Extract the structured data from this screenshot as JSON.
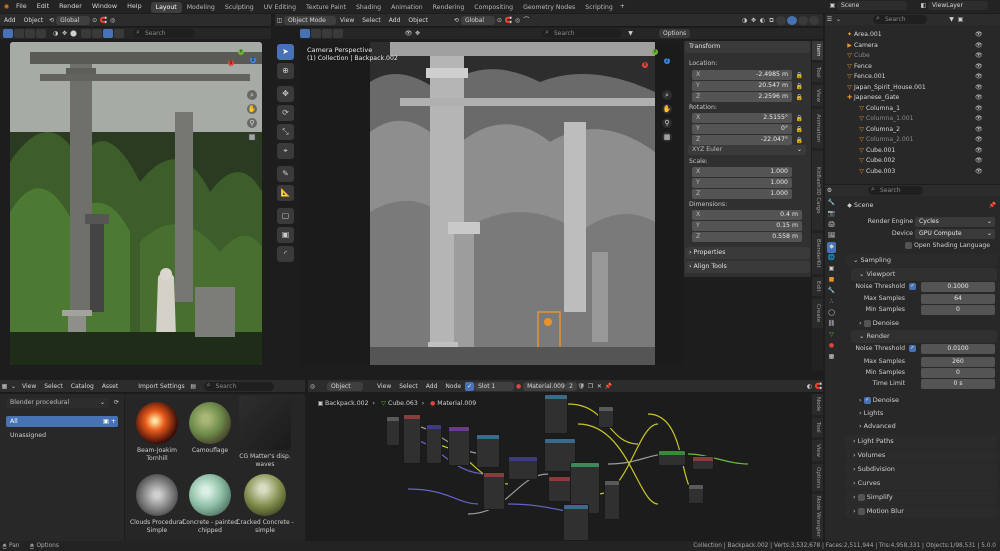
{
  "menubar": {
    "items": [
      "File",
      "Edit",
      "Render",
      "Window",
      "Help"
    ],
    "workspaces": [
      "Layout",
      "Modeling",
      "Sculpting",
      "UV Editing",
      "Texture Paint",
      "Shading",
      "Animation",
      "Rendering",
      "Compositing",
      "Geometry Nodes",
      "Scripting"
    ],
    "active_workspace": "Layout",
    "scene": "Scene",
    "view_layer": "ViewLayer"
  },
  "left_viewport": {
    "header": {
      "add": "Add",
      "object": "Object",
      "orientation": "Global",
      "search_placeholder": "Search"
    }
  },
  "main_viewport": {
    "header": {
      "mode": "Object Mode",
      "view": "View",
      "select": "Select",
      "add": "Add",
      "object": "Object",
      "orientation": "Global",
      "search_placeholder": "Search",
      "options": "Options"
    },
    "overlay_title": "Camera Perspective",
    "overlay_sub": "(1) Collection | Backpack.002"
  },
  "npanel": {
    "tabs": [
      "Item",
      "Tool",
      "View",
      "Animation",
      "KitBash3D Cargo",
      "BlenderKit",
      "Edit",
      "Create"
    ],
    "transform": "Transform",
    "location": "Location:",
    "loc": [
      {
        "k": "X",
        "v": "-2.4985 m"
      },
      {
        "k": "Y",
        "v": "20.547 m"
      },
      {
        "k": "Z",
        "v": "2.2596 m"
      }
    ],
    "rotation": "Rotation:",
    "rot": [
      {
        "k": "X",
        "v": "2.5155°"
      },
      {
        "k": "Y",
        "v": "0°"
      },
      {
        "k": "Z",
        "v": "-22.047°"
      }
    ],
    "rot_mode": "XYZ Euler",
    "scale": "Scale:",
    "scl": [
      {
        "k": "X",
        "v": "1.000"
      },
      {
        "k": "Y",
        "v": "1.000"
      },
      {
        "k": "Z",
        "v": "1.000"
      }
    ],
    "dimensions": "Dimensions:",
    "dim": [
      {
        "k": "X",
        "v": "0.4 m"
      },
      {
        "k": "Y",
        "v": "0.15 m"
      },
      {
        "k": "Z",
        "v": "0.558 m"
      }
    ],
    "properties": "Properties",
    "align_tools": "Align Tools"
  },
  "outliner": {
    "search_placeholder": "Search",
    "rows": [
      {
        "name": "Area.001",
        "indent": 0
      },
      {
        "name": "Camera",
        "indent": 0
      },
      {
        "name": "Cube",
        "indent": 0
      },
      {
        "name": "Fence",
        "indent": 0
      },
      {
        "name": "Fence.001",
        "indent": 0
      },
      {
        "name": "Japan_Spirit_House.001",
        "indent": 0
      },
      {
        "name": "Japanese_Gate",
        "indent": 0
      },
      {
        "name": "Columna_1",
        "indent": 1
      },
      {
        "name": "Columna_1.001",
        "indent": 1
      },
      {
        "name": "Columna_2",
        "indent": 1
      },
      {
        "name": "Columna_2.001",
        "indent": 1
      },
      {
        "name": "Cube.001",
        "indent": 1
      },
      {
        "name": "Cube.002",
        "indent": 1
      },
      {
        "name": "Cube.003",
        "indent": 1
      }
    ]
  },
  "properties": {
    "search_placeholder": "Search",
    "context": "Scene",
    "render_engine_label": "Render Engine",
    "render_engine": "Cycles",
    "device_label": "Device",
    "device": "GPU Compute",
    "osl": "Open Shading Language",
    "sampling": "Sampling",
    "viewport": "Viewport",
    "vp_noise_label": "Noise Threshold",
    "vp_noise": "0.1000",
    "vp_max_label": "Max Samples",
    "vp_max": "64",
    "vp_min_label": "Min Samples",
    "vp_min": "0",
    "denoise": "Denoise",
    "render": "Render",
    "r_noise_label": "Noise Threshold",
    "r_noise": "0.0100",
    "r_max_label": "Max Samples",
    "r_max": "260",
    "r_min_label": "Min Samples",
    "r_min": "0",
    "time_label": "Time Limit",
    "time": "0 s",
    "denoise2": "Denoise",
    "lights": "Lights",
    "advanced": "Advanced",
    "panels": [
      "Light Paths",
      "Volumes",
      "Subdivision",
      "Curves",
      "Simplify",
      "Motion Blur"
    ]
  },
  "asset_browser": {
    "view": "View",
    "select": "Select",
    "catalog": "Catalog",
    "asset": "Asset",
    "import": "Import Settings",
    "search_placeholder": "Search",
    "library": "Blender procedural",
    "all": "All",
    "unassigned": "Unassigned",
    "assets": [
      {
        "name": "Beam-Joakim Tornhill",
        "color": "#c0391d"
      },
      {
        "name": "Camouflage",
        "color": "#6c8a4a"
      },
      {
        "name": "CG Matter's disp. waves",
        "color": "#2a2a2a"
      },
      {
        "name": "Clouds Procedural Simple",
        "color": "#8e8e8e"
      },
      {
        "name": "Concrete - painted chipped",
        "color": "#8fbfa8"
      },
      {
        "name": "Cracked Concrete - simple",
        "color": "#7f8b4a"
      }
    ]
  },
  "node_editor": {
    "object": "Object",
    "view": "View",
    "select": "Select",
    "add": "Add",
    "node": "Node",
    "slot": "Slot 1",
    "material": "Material.009",
    "users": "2",
    "breadcrumb": [
      "Backpack.002",
      "Cube.063",
      "Material.009"
    ],
    "tabs": [
      "Node",
      "Tool",
      "View",
      "Options",
      "Node Wrangler"
    ]
  },
  "statusbar": {
    "left": [
      "Pan",
      "Options"
    ],
    "right": "Collection | Backpack.002 | Verts:3,532,678 | Faces:2,511,944 | Tris:4,958,331 | Objects:1/98,531 | 5.0.0"
  }
}
